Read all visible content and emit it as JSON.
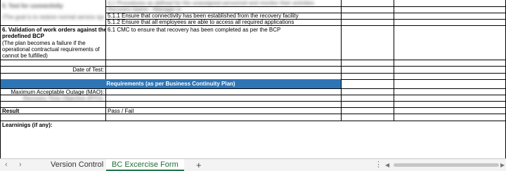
{
  "rows": {
    "test_connectivity": {
      "label": "5. Test for connectivity",
      "sublabel": "(The goal is to restore normal service operations)",
      "top_blurred_right": "4.1 Procedures as defined for the unassigned personnel and monitor their activities",
      "second_blurred_right": "Recovery teams - Manager is",
      "items": [
        "5.1.1 Ensure that connectivity has been established from the recovery facility",
        "5.1.2 Ensure that all employees are able to access all required applications"
      ]
    },
    "validation": {
      "title_line1": "6. Validation of work orders against the",
      "title_line2": "predefined BCP",
      "desc_line1": "(The plan becomes a failure if the",
      "desc_line2": "operational contractual requirements of",
      "desc_line3": "cannot be fulfilled)",
      "item": "6.1 CMC to ensure that recovery has been completed as per the BCP"
    },
    "date_of_test": "Date of Test:",
    "requirements_banner": "Requirements (as per Business Continuity Plan)",
    "mao_label": "Maximum Acceptable Outage (MAO):",
    "rto_label": "Recovery Time Objective (RTO):",
    "result_label": "Result",
    "result_value": "Pass / Fail",
    "learnings_label": "Learninigs (if any):"
  },
  "tabs": {
    "prev_arrow": "‹",
    "next_arrow": "›",
    "version_control": "Version Control",
    "bc_form": "BC Excercise Form",
    "add": "+",
    "more": "⋮"
  },
  "colors": {
    "banner": "#2e75b6",
    "active_tab": "#217346"
  }
}
